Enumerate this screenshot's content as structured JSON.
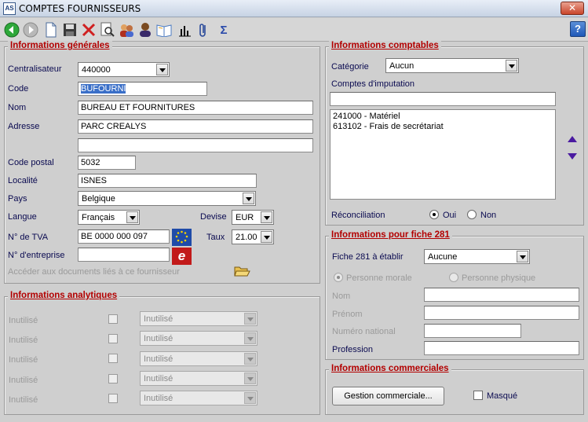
{
  "window": {
    "title": "COMPTES FOURNISSEURS",
    "app_icon_text": "AS",
    "close_glyph": "✕"
  },
  "toolbar": {
    "help_glyph": "?"
  },
  "general": {
    "title": "Informations générales",
    "centralisateur_label": "Centralisateur",
    "centralisateur_value": "440000",
    "code_label": "Code",
    "code_value": "BUFOURNI",
    "nom_label": "Nom",
    "nom_value": "BUREAU ET FOURNITURES",
    "adresse_label": "Adresse",
    "adresse_value": "PARC CREALYS",
    "adresse2_value": "",
    "code_postal_label": "Code postal",
    "code_postal_value": "5032",
    "localite_label": "Localité",
    "localite_value": "ISNES",
    "pays_label": "Pays",
    "pays_value": "Belgique",
    "langue_label": "Langue",
    "langue_value": "Français",
    "devise_label": "Devise",
    "devise_value": "EUR",
    "tva_label": "N° de TVA",
    "tva_value": "BE 0000 000 097",
    "taux_label": "Taux",
    "taux_value": "21.00",
    "entreprise_label": "N° d'entreprise",
    "entreprise_value": "",
    "documents_label": "Accéder aux documents liés à ce fournisseur"
  },
  "analytique": {
    "title": "Informations analytiques",
    "rows": [
      {
        "label": "Inutilisé",
        "value": "Inutilisé"
      },
      {
        "label": "Inutilisé",
        "value": "Inutilisé"
      },
      {
        "label": "Inutilisé",
        "value": "Inutilisé"
      },
      {
        "label": "Inutilisé",
        "value": "Inutilisé"
      },
      {
        "label": "Inutilisé",
        "value": "Inutilisé"
      }
    ]
  },
  "comptables": {
    "title": "Informations comptables",
    "categorie_label": "Catégorie",
    "categorie_value": "Aucun",
    "imputation_label": "Comptes d'imputation",
    "imputation_input": "",
    "comptes": [
      "241000 - Matériel",
      "613102 - Frais de secrétariat"
    ],
    "reconciliation_label": "Réconciliation",
    "oui": "Oui",
    "non": "Non",
    "reconciliation_selected": "Oui"
  },
  "fiche281": {
    "title": "Informations pour fiche 281",
    "fiche_label": "Fiche 281 à établir",
    "fiche_value": "Aucune",
    "personne_morale": "Personne morale",
    "personne_physique": "Personne physique",
    "nom_label": "Nom",
    "prenom_label": "Prénom",
    "numero_national_label": "Numéro national",
    "profession_label": "Profession",
    "nom_value": "",
    "prenom_value": "",
    "numero_national_value": "",
    "profession_value": ""
  },
  "commerciales": {
    "title": "Informations commerciales",
    "gestion_button": "Gestion commerciale...",
    "masque_label": "Masqué"
  }
}
